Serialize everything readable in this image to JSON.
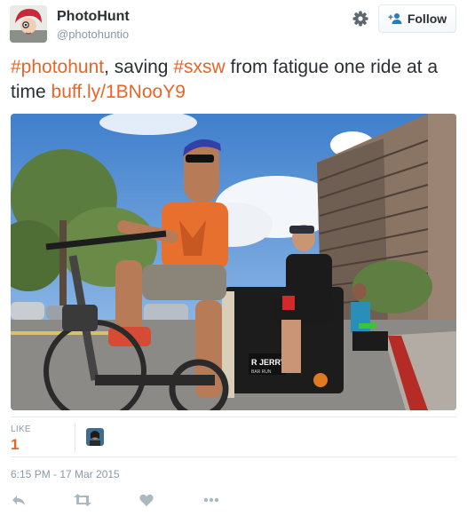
{
  "user": {
    "name": "PhotoHunt",
    "handle": "@photohuntio"
  },
  "header": {
    "follow_label": "Follow",
    "settings_icon": "gear-icon"
  },
  "tweet": {
    "parts": [
      {
        "text": "#photohunt",
        "link": true
      },
      {
        "text": ", saving ",
        "link": false
      },
      {
        "text": "#sxsw",
        "link": true
      },
      {
        "text": " from fatigue one ride at a time ",
        "link": false
      },
      {
        "text": "buff.ly/1BNooY9",
        "link": true
      }
    ],
    "photo_signs": {
      "pedicab_text": "R JERRY",
      "pedicab_subtext": "BAR RUN"
    }
  },
  "stats": {
    "like_label": "LIKE",
    "like_count": "1"
  },
  "timestamp": "6:15 PM - 17 Mar 2015",
  "actions": [
    "reply-icon",
    "retweet-icon",
    "like-icon",
    "more-icon"
  ],
  "colors": {
    "link": "#e6652a",
    "muted": "#8899a6",
    "text": "#292f33",
    "border": "#e1e8ed"
  }
}
